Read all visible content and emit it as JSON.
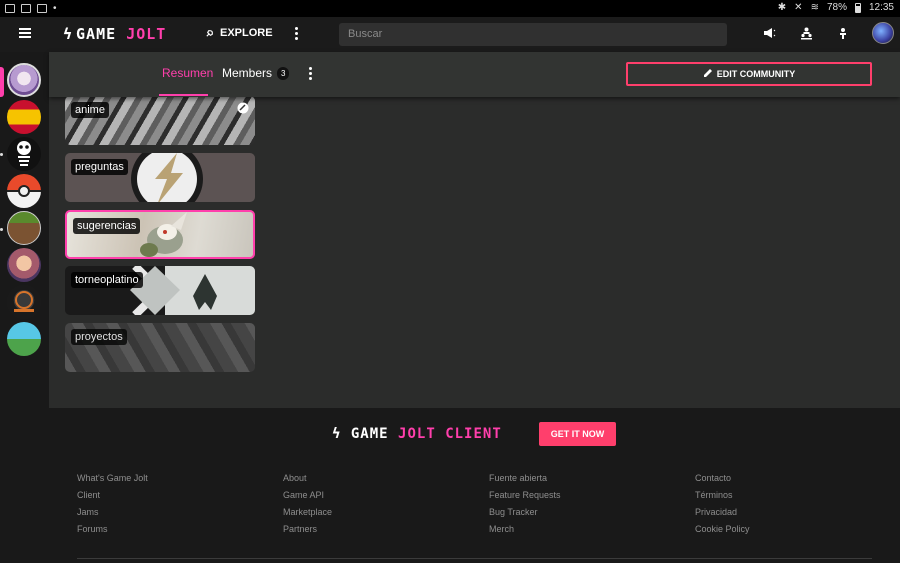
{
  "statusbar": {
    "battery": "78%",
    "time": "12:35"
  },
  "topnav": {
    "logo_bolt": "ϟ",
    "logo_game": "GAME",
    "logo_jolt": "JOLT",
    "explore_icon": "rocket-icon",
    "explore_label": "EXPLORE",
    "search_placeholder": "Buscar"
  },
  "sidebar": {
    "communities": [
      {
        "name": "avatar-girl",
        "colors": [
          "#d9d0e6",
          "#8b6ab0"
        ]
      },
      {
        "name": "spain-flag",
        "colors": [
          "#e4252c",
          "#f6c300"
        ]
      },
      {
        "name": "skeleton",
        "colors": [
          "#111111",
          "#ffffff"
        ]
      },
      {
        "name": "pokeball",
        "colors": [
          "#e94a2b",
          "#f2f2f2"
        ]
      },
      {
        "name": "minecraft-block",
        "colors": [
          "#5a8a2d",
          "#7b5332"
        ]
      },
      {
        "name": "anime-girl",
        "colors": [
          "#e6a27c",
          "#7a4b8c"
        ]
      },
      {
        "name": "atlas-zero",
        "colors": [
          "#1e1e1e",
          "#d7742b"
        ]
      },
      {
        "name": "landscape",
        "colors": [
          "#57c7e6",
          "#4da34b"
        ]
      }
    ],
    "add_icon": "+"
  },
  "community_header": {
    "tab_resumen": "Resumen",
    "tab_members": "Members",
    "members_count": "3",
    "edit_icon": "pencil-icon",
    "edit_label": "EDIT COMMUNITY"
  },
  "channels": [
    {
      "label": "anime"
    },
    {
      "label": "preguntas"
    },
    {
      "label": "sugerencias"
    },
    {
      "label": "torneoplatino"
    },
    {
      "label": "proyectos"
    }
  ],
  "footer": {
    "client_game": "GAME",
    "client_jolt": "JOLT",
    "client_client": "CLIENT",
    "get_it": "GET IT NOW",
    "col1": [
      "What's Game Jolt",
      "Client",
      "Jams",
      "Forums"
    ],
    "col2": [
      "About",
      "Game API",
      "Marketplace",
      "Partners"
    ],
    "col3": [
      "Fuente abierta",
      "Feature Requests",
      "Bug Tracker",
      "Merch"
    ],
    "col4": [
      "Contacto",
      "Términos",
      "Privacidad",
      "Cookie Policy"
    ]
  },
  "colors": {
    "accent": "#ff3fac",
    "button_accent": "#ff3f6c"
  }
}
